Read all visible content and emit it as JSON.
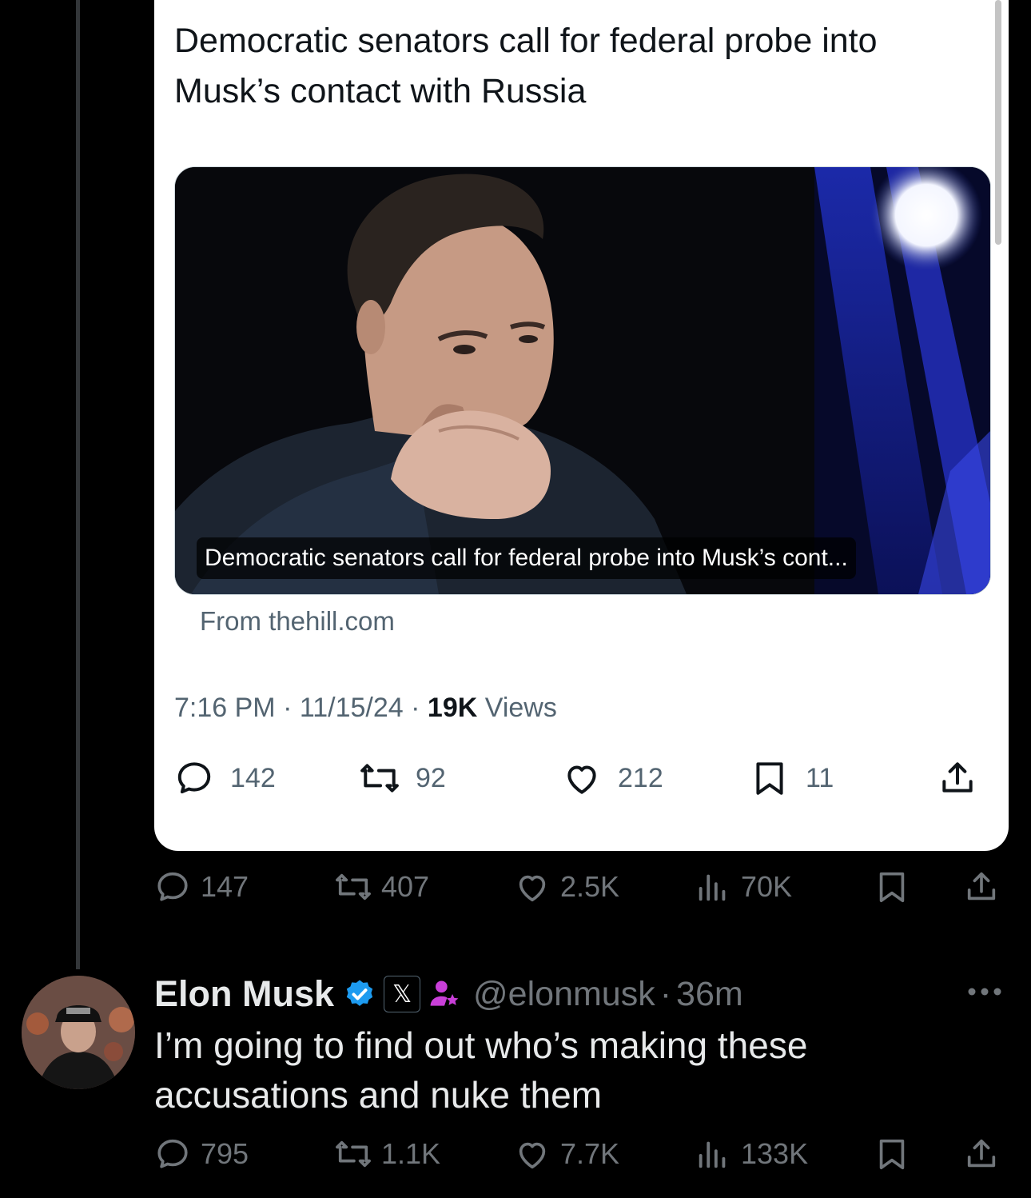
{
  "quoted_post": {
    "headline": "Democratic senators call for federal probe into Musk’s contact with Russia",
    "media_caption": "Democratic senators call for federal probe into Musk’s cont...",
    "source": "From thehill.com",
    "time": "7:16 PM",
    "date": "11/15/24",
    "separator": "·",
    "views_count": "19K",
    "views_label": "Views",
    "replies": "142",
    "reposts": "92",
    "likes": "212",
    "bookmarks": "11"
  },
  "parent_post_actions": {
    "replies": "147",
    "reposts": "407",
    "likes": "2.5K",
    "views": "70K"
  },
  "reply_post": {
    "name": "Elon Musk",
    "affiliate_badge": "𝕏",
    "handle": "@elonmusk",
    "separator": "·",
    "time": "36m",
    "text": "I’m going to find out who’s making these accusations and nuke them",
    "replies": "795",
    "reposts": "1.1K",
    "likes": "7.7K",
    "views": "133K"
  },
  "colors": {
    "background": "#000000",
    "card": "#ffffff",
    "verified_blue": "#1d9bf0",
    "muted": "#71767b",
    "accent_purple": "#c93fd8"
  },
  "icons": [
    "reply-icon",
    "repost-icon",
    "like-icon",
    "views-icon",
    "bookmark-icon",
    "share-icon",
    "verified-badge-icon",
    "subscriber-icon",
    "more-icon"
  ]
}
